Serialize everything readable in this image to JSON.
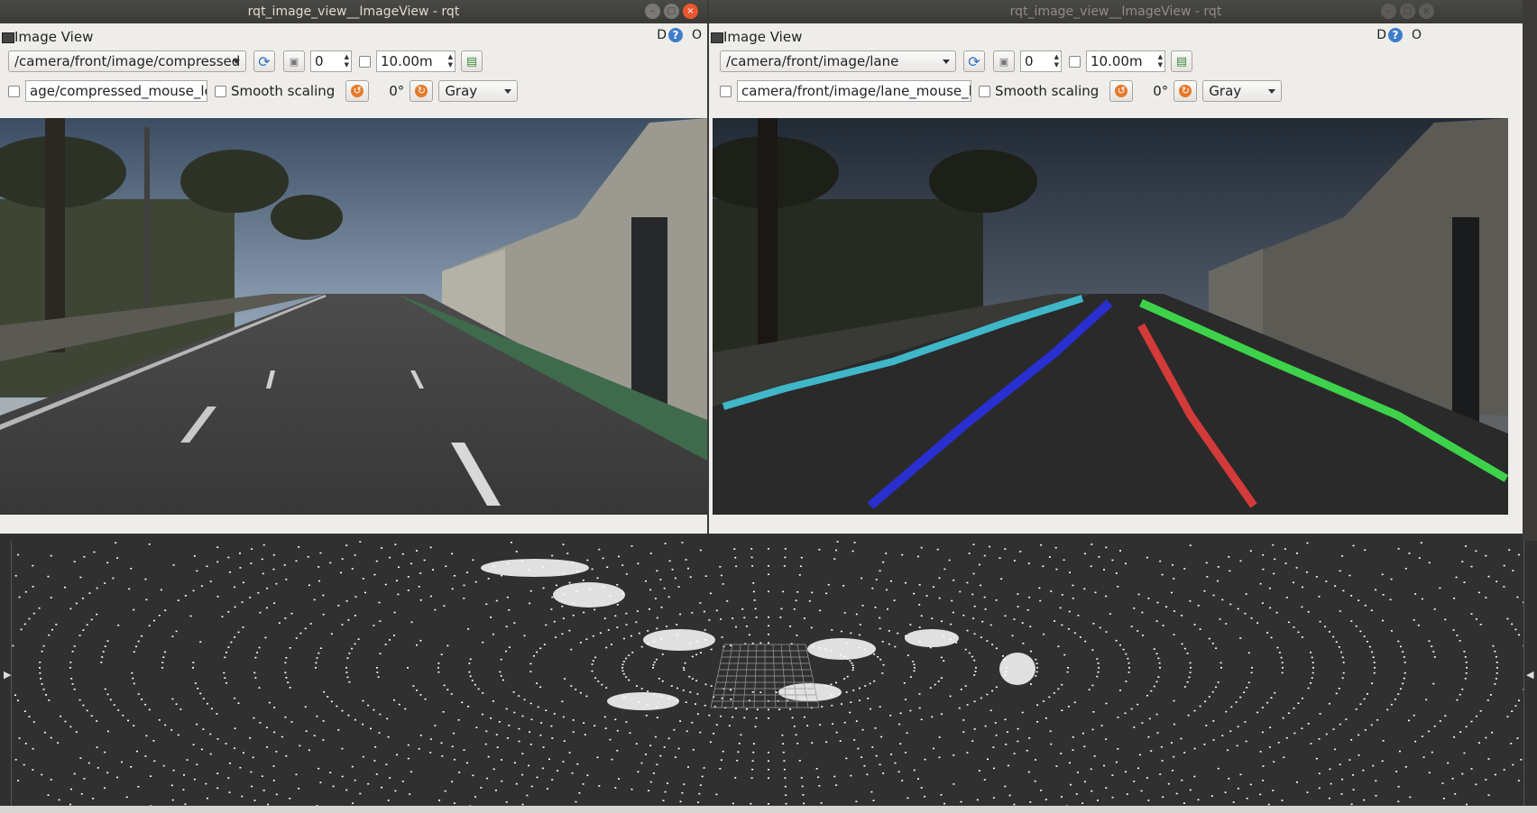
{
  "left_window": {
    "title": "rqt_image_view__ImageView - rqt",
    "panel_title": "Image View",
    "d_label": "D",
    "help_label": "?",
    "o_label": "O",
    "topic": "/camera/front/image/compressed",
    "spin_value": "0",
    "max_range": "10.00m",
    "mouse_topic": "age/compressed_mouse_left",
    "smooth_scaling_label": "Smooth scaling",
    "rotation_label": "0°",
    "color_scheme": "Gray",
    "image_name": "road-camera-image"
  },
  "right_window": {
    "title": "rqt_image_view__ImageView - rqt",
    "panel_title": "Image View",
    "d_label": "D",
    "help_label": "?",
    "o_label": "O",
    "topic": "/camera/front/image/lane",
    "spin_value": "0",
    "max_range": "10.00m",
    "mouse_topic": "camera/front/image/lane_mouse_left",
    "smooth_scaling_label": "Smooth scaling",
    "rotation_label": "0°",
    "color_scheme": "Gray",
    "lane_colors": [
      "#3fb7c9",
      "#2a2fcf",
      "#d33a3a",
      "#3dd24a"
    ]
  },
  "window_buttons": {
    "minimize": "–",
    "maximize": "□",
    "close": "×"
  },
  "lidar_view": {
    "name": "point-cloud-3d-view"
  }
}
